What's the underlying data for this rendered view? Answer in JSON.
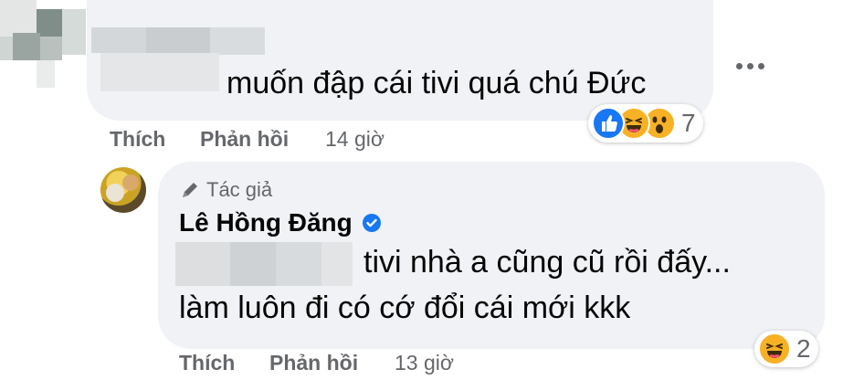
{
  "comment1": {
    "text": "muốn đập cái tivi quá chú Đức",
    "actions": {
      "like": "Thích",
      "reply": "Phản hồi"
    },
    "time": "14 giờ",
    "reaction_count": "7",
    "reaction_icons": [
      "like-icon",
      "haha-icon",
      "wow-icon"
    ]
  },
  "reply": {
    "author_badge": "Tác giả",
    "author_name": "Lê Hồng Đăng",
    "text_line1": "tivi nhà a cũng cũ rồi đấy...",
    "text_line2": "làm luôn đi có cớ đổi cái mới kkk",
    "actions": {
      "like": "Thích",
      "reply": "Phản hồi"
    },
    "time": "13 giờ",
    "reaction_count": "2",
    "reaction_icons": [
      "haha-icon"
    ]
  },
  "colors": {
    "bubble": "#f0f2f5",
    "secondary_text": "#65676b",
    "like_blue": "#1877f2",
    "haha_yellow": "#f7b125",
    "verified_blue": "#1877f2"
  }
}
